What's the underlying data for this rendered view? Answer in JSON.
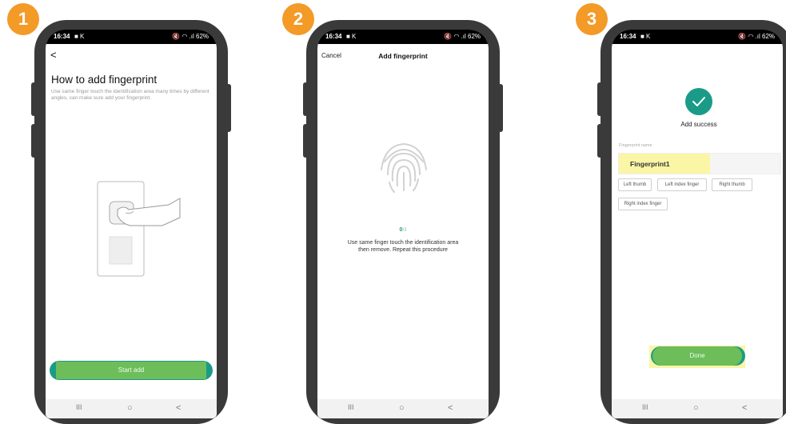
{
  "status_bar": {
    "time": "16:34",
    "icons_text": "🔇 ◠ .ıl 62%"
  },
  "nav_bar": {
    "recents": "III",
    "home": "○",
    "back": "<"
  },
  "badges": [
    "1",
    "2",
    "3"
  ],
  "step1": {
    "back_glyph": "<",
    "title": "How to add fingerprint",
    "description": "Use same finger touch the identification area many times by different angles, can make sure add your fingerprint.",
    "start_button": "Start add"
  },
  "step2": {
    "cancel": "Cancel",
    "title": "Add fingerprint",
    "progress_current": "0",
    "progress_total": "/3",
    "instructions": "Use same finger touch the identification area then remove. Repeat this procedure"
  },
  "step3": {
    "success_label": "Add success",
    "field_label": "Fingerprint name",
    "field_value": "Fingerprint1",
    "chips": [
      "Left thumb",
      "Left index finger",
      "Right thumb",
      "Right index finger"
    ],
    "done_button": "Done"
  },
  "colors": {
    "badge": "#f39a27",
    "accent_green": "#6dbd5a",
    "teal": "#1a9b87",
    "highlight_yellow": "#fbf5a6"
  }
}
